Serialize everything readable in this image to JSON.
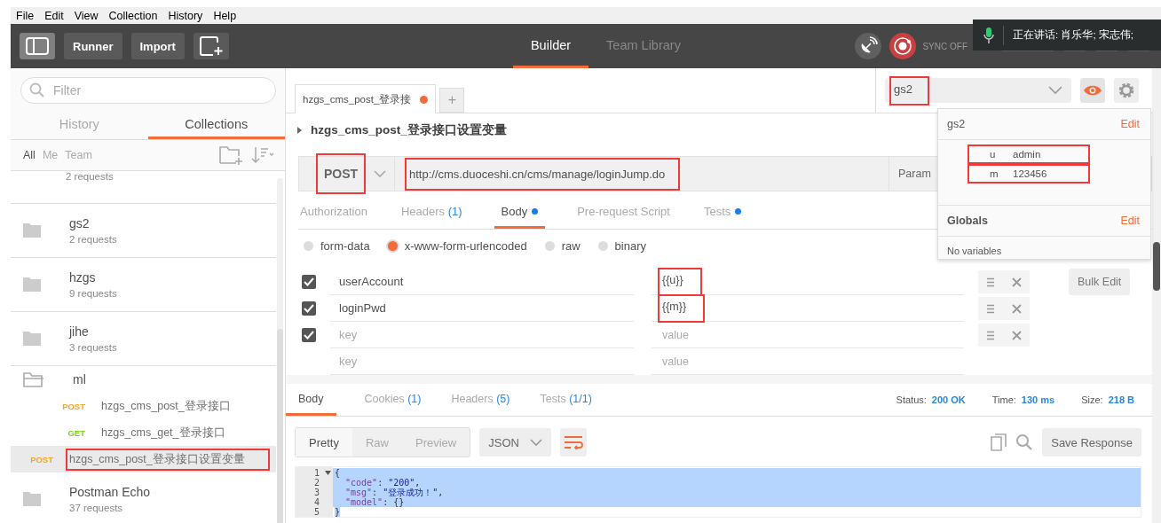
{
  "menu": [
    "File",
    "Edit",
    "View",
    "Collection",
    "History",
    "Help"
  ],
  "header": {
    "buttons": [
      "Runner",
      "Import"
    ],
    "tabs": [
      {
        "label": "Builder",
        "selected": true
      },
      {
        "label": "Team Library",
        "selected": false
      }
    ],
    "sync": "SYNC OFF"
  },
  "voice_overlay": {
    "text": "正在讲话: 肖乐华; 宋志伟;"
  },
  "sidebar": {
    "filter": {
      "placeholder": "Filter"
    },
    "tabs": [
      {
        "label": "History",
        "selected": false
      },
      {
        "label": "Collections",
        "selected": true
      }
    ],
    "scope": [
      {
        "label": "All",
        "selected": true
      },
      {
        "label": "Me",
        "selected": false
      },
      {
        "label": "Team",
        "selected": false
      }
    ],
    "collections": [
      {
        "count": "2 requests",
        "expanded": false
      },
      {
        "name": "gs2",
        "count": "2 requests",
        "expanded": false
      },
      {
        "name": "hzgs",
        "count": "9 requests",
        "expanded": false
      },
      {
        "name": "jihe",
        "count": "3 requests",
        "expanded": false
      },
      {
        "name": "ml",
        "expanded": true,
        "children": [
          {
            "method": "POST",
            "color": "#f5a623",
            "name": "hzgs_cms_post_登录接口",
            "selected": false,
            "annotated": false
          },
          {
            "method": "GET",
            "color": "#7ed321",
            "name": "hzgs_cms_get_登录接口",
            "selected": false,
            "annotated": false
          },
          {
            "method": "POST",
            "color": "#f5a623",
            "name": "hzgs_cms_post_登录接口设置变量",
            "selected": true,
            "annotated": true
          }
        ]
      },
      {
        "name": "Postman Echo",
        "count": "37 requests",
        "expanded": false
      }
    ]
  },
  "request_tabs": [
    {
      "label": "hzgs_cms_post_登录接",
      "unsaved": true,
      "selected": true
    }
  ],
  "new_tab": "+",
  "environment": {
    "value": "gs2",
    "annotated": true
  },
  "request": {
    "title": "hzgs_cms_post_登录接口设置变量",
    "method": "POST",
    "method_annotated": true,
    "url": "http://cms.duoceshi.cn/cms/manage/loginJump.do",
    "url_annotated": true,
    "params_button": "Param"
  },
  "request_sections": [
    {
      "label": "Authorization",
      "selected": false,
      "dot": false
    },
    {
      "label": "Headers",
      "count": "(1)",
      "selected": false,
      "dot": false
    },
    {
      "label": "Body",
      "selected": true,
      "dot": true
    },
    {
      "label": "Pre-request Script",
      "selected": false,
      "dot": false
    },
    {
      "label": "Tests",
      "selected": false,
      "dot": true
    }
  ],
  "body_types": [
    {
      "label": "form-data",
      "selected": false
    },
    {
      "label": "x-www-form-urlencoded",
      "selected": true
    },
    {
      "label": "raw",
      "selected": false
    },
    {
      "label": "binary",
      "selected": false
    }
  ],
  "params": [
    {
      "kind": "row",
      "checked": true,
      "key": "userAccount",
      "value": "{{u}}",
      "annotated": true
    },
    {
      "kind": "row",
      "checked": true,
      "key": "loginPwd",
      "value": "{{m}}",
      "annotated": true
    },
    {
      "kind": "row",
      "checked": true,
      "key_placeholder": "key",
      "value_placeholder": "value",
      "annotated": false
    },
    {
      "kind": "new",
      "key_placeholder": "key",
      "value_placeholder": "value",
      "annotated": false
    }
  ],
  "bulk_edit": "Bulk Edit",
  "response": {
    "tabs": [
      {
        "label": "Body",
        "selected": true
      },
      {
        "label": "Cookies",
        "count": "(1)",
        "selected": false
      },
      {
        "label": "Headers",
        "count": "(5)",
        "selected": false
      },
      {
        "label": "Tests",
        "count": "(1/1)",
        "selected": false
      }
    ],
    "stats": [
      {
        "label": "Status:",
        "value": "200 OK"
      },
      {
        "label": "Time:",
        "value": "130 ms"
      },
      {
        "label": "Size:",
        "value": "218 B"
      }
    ],
    "views": [
      {
        "label": "Pretty",
        "selected": true
      },
      {
        "label": "Raw",
        "selected": false
      },
      {
        "label": "Preview",
        "selected": false
      }
    ],
    "format": "JSON",
    "save": "Save Response",
    "lines": [
      {
        "number": "1",
        "foldable": true,
        "indented": false,
        "parts": [
          {
            "kind": "punct",
            "text": "{"
          }
        ]
      },
      {
        "number": "2",
        "foldable": false,
        "indented": true,
        "parts": [
          {
            "kind": "key",
            "text": "\"code\""
          },
          {
            "kind": "punct",
            "text": ": "
          },
          {
            "kind": "string",
            "text": "\"200\""
          },
          {
            "kind": "punct",
            "text": ","
          }
        ]
      },
      {
        "number": "3",
        "foldable": false,
        "indented": true,
        "parts": [
          {
            "kind": "key",
            "text": "\"msg\""
          },
          {
            "kind": "punct",
            "text": ": "
          },
          {
            "kind": "string",
            "text": "\"登录成功！\""
          },
          {
            "kind": "punct",
            "text": ","
          }
        ]
      },
      {
        "number": "4",
        "foldable": false,
        "indented": true,
        "parts": [
          {
            "kind": "key",
            "text": "\"model\""
          },
          {
            "kind": "punct",
            "text": ": {}"
          }
        ]
      },
      {
        "number": "5",
        "foldable": false,
        "indented": false,
        "parts": [
          {
            "kind": "punct",
            "text": "}"
          }
        ]
      }
    ]
  },
  "env_popup": {
    "name": "gs2",
    "edit": "Edit",
    "variables": [
      {
        "key": "u",
        "value": "admin",
        "annotated": true
      },
      {
        "key": "m",
        "value": "123456",
        "annotated": true
      }
    ],
    "globals": "Globals",
    "globals_edit": "Edit",
    "empty": "No variables"
  }
}
